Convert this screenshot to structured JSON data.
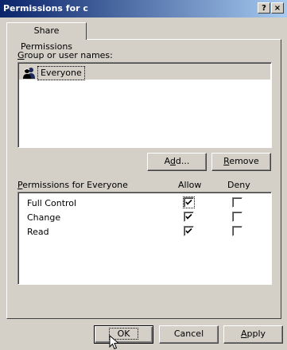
{
  "window": {
    "title": "Permissions for c"
  },
  "titlebar": {
    "help": "?",
    "close": "×"
  },
  "tabs": [
    {
      "label": "Share Permissions",
      "selected": true
    }
  ],
  "groups": {
    "label_accesskey": "G",
    "label_rest": "roup or user names:",
    "items": [
      {
        "name": "Everyone",
        "icon": "group-users-icon",
        "selected": true
      }
    ]
  },
  "group_buttons": {
    "add": {
      "pre": "A",
      "key": "d",
      "post": "d..."
    },
    "remove": {
      "key": "R",
      "post": "emove"
    }
  },
  "permissions": {
    "header_key": "P",
    "header_rest": "ermissions for Everyone",
    "allow_label": "Allow",
    "deny_label": "Deny",
    "rows": [
      {
        "name": "Full Control",
        "allow": true,
        "deny": false
      },
      {
        "name": "Change",
        "allow": true,
        "deny": false
      },
      {
        "name": "Read",
        "allow": true,
        "deny": false
      }
    ]
  },
  "footer": {
    "ok": "OK",
    "cancel": "Cancel",
    "apply": {
      "key": "A",
      "post": "pply"
    }
  }
}
